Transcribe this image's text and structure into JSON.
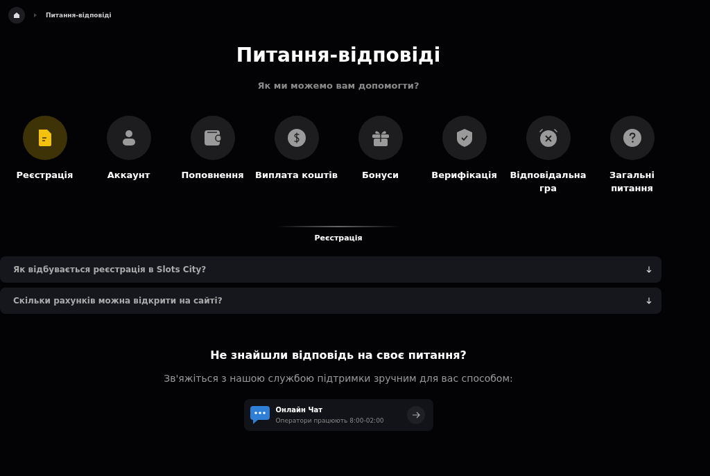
{
  "breadcrumb": {
    "current": "Питання-відповіді"
  },
  "title": "Питання-відповіді",
  "subtitle": "Як ми можемо вам допомогти?",
  "categories": [
    {
      "label": "Реєстрація",
      "kind": "document",
      "selected": true
    },
    {
      "label": "Аккаунт",
      "kind": "person",
      "selected": false
    },
    {
      "label": "Поповнення",
      "kind": "wallet",
      "selected": false
    },
    {
      "label": "Виплата коштів",
      "kind": "coin",
      "selected": false
    },
    {
      "label": "Бонуси",
      "kind": "gift",
      "selected": false
    },
    {
      "label": "Верифікація",
      "kind": "shield",
      "selected": false
    },
    {
      "label": "Відповідальна гра",
      "kind": "alarm",
      "selected": false
    },
    {
      "label": "Загальні питання",
      "kind": "question",
      "selected": false
    }
  ],
  "section_title": "Реєстрація",
  "questions": [
    {
      "text": "Як відбувається реєстрація в Slots City?",
      "expanded": false
    },
    {
      "text": "Скільки рахунків можна відкрити на сайті?",
      "expanded": false
    }
  ],
  "help": {
    "title": "Не знайшли відповідь на своє питання?",
    "subtitle": "Зв'яжіться з нашою службою підтримки зручним для вас способом:"
  },
  "contacts": [
    {
      "title": "Онлайн Чат",
      "subtitle": "Оператори працюють 8:00-02:00"
    }
  ]
}
